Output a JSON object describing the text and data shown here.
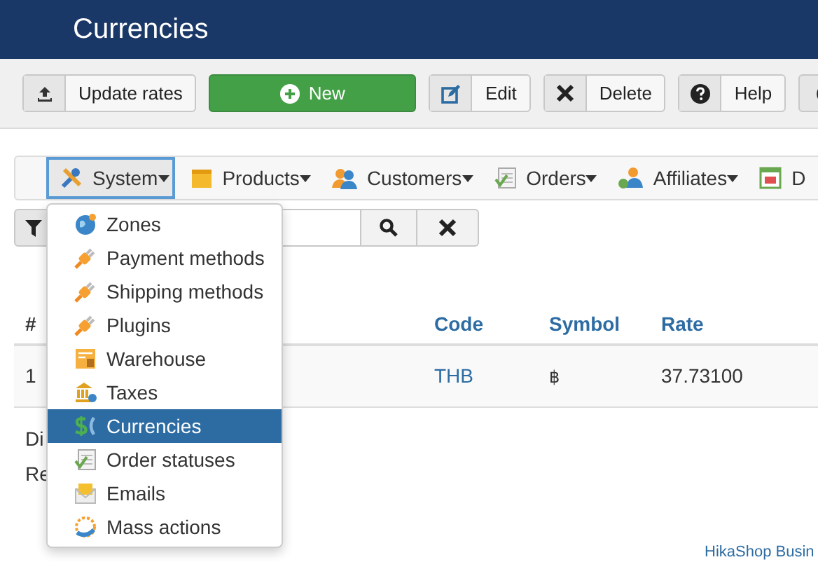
{
  "header": {
    "title": "Currencies"
  },
  "toolbar": [
    {
      "kind": "split",
      "label": "Update rates"
    },
    {
      "kind": "primary",
      "label": "New"
    },
    {
      "kind": "split",
      "label": "Edit"
    },
    {
      "kind": "split",
      "label": "Delete"
    },
    {
      "kind": "split",
      "label": "Help"
    },
    {
      "kind": "icon-only"
    }
  ],
  "menu": [
    {
      "label": "System",
      "selected": true
    },
    {
      "label": "Products",
      "selected": false
    },
    {
      "label": "Customers",
      "selected": false
    },
    {
      "label": "Orders",
      "selected": false
    },
    {
      "label": "Affiliates",
      "selected": false
    },
    {
      "label": "D",
      "selected": false
    }
  ],
  "dropdown": [
    {
      "label": "Zones",
      "selected": false
    },
    {
      "label": "Payment methods",
      "selected": false
    },
    {
      "label": "Shipping methods",
      "selected": false
    },
    {
      "label": "Plugins",
      "selected": false
    },
    {
      "label": "Warehouse",
      "selected": false
    },
    {
      "label": "Taxes",
      "selected": false
    },
    {
      "label": "Currencies",
      "selected": true
    },
    {
      "label": "Order statuses",
      "selected": false
    },
    {
      "label": "Emails",
      "selected": false
    },
    {
      "label": "Mass actions",
      "selected": false
    }
  ],
  "table": {
    "columns": [
      "#",
      "Code",
      "Symbol",
      "Rate"
    ],
    "rows": [
      {
        "cells": [
          "1",
          "THB",
          "฿",
          "37.73100"
        ]
      }
    ]
  },
  "notes": [
    "Di",
    "Re"
  ],
  "credit": "HikaShop Busin"
}
